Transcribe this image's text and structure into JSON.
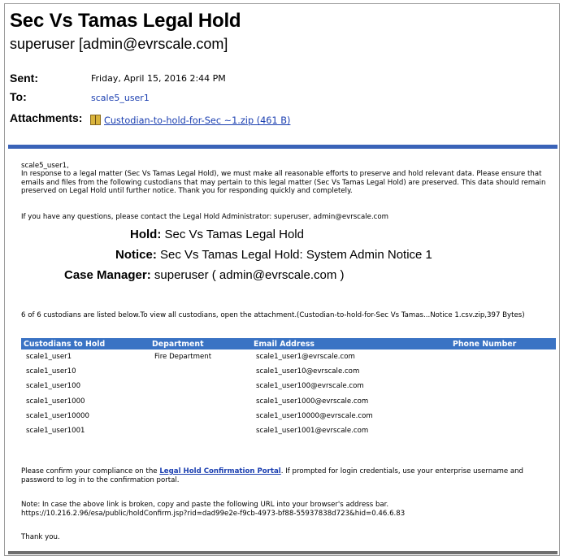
{
  "email": {
    "subject": "Sec Vs Tamas Legal Hold",
    "sender": "superuser [admin@evrscale.com]",
    "sent_label": "Sent:",
    "sent_value": "Friday, April 15, 2016 2:44 PM",
    "to_label": "To:",
    "to_value": "scale5_user1",
    "attachments_label": "Attachments:",
    "attachment_name": "Custodian-to-hold-for-Sec ~1.zip (461 B)",
    "attachment_icon": "zip-file-icon"
  },
  "body": {
    "greeting": "scale5_user1,",
    "paragraph": "In response to a legal matter (Sec Vs Tamas Legal Hold), we must make all reasonable efforts to preserve and hold relevant data. Please ensure that emails and files from the following custodians that may pertain to this legal matter (Sec Vs Tamas Legal Hold) are preserved. This data should remain preserved on Legal Hold until further notice. Thank you for responding quickly and completely.",
    "contact": "If you have any questions, please contact the Legal Hold Administrator: superuser, admin@evrscale.com",
    "hold_label": "Hold:",
    "hold_value": "Sec Vs Tamas Legal Hold",
    "notice_label": "Notice:",
    "notice_value": "Sec Vs Tamas Legal Hold: System Admin Notice 1",
    "case_manager_label": "Case Manager:",
    "case_manager_value": "superuser ( admin@evrscale.com )",
    "custodian_summary": "6 of 6 custodians are listed below.To view all custodians, open the attachment.(Custodian-to-hold-for-Sec Vs Tamas...Notice 1.csv.zip,397 Bytes)",
    "confirm_pre": "Please confirm your compliance on the ",
    "confirm_link": "Legal Hold Confirmation Portal",
    "confirm_post": ". If prompted for login credentials, use your enterprise username and password to log in to the confirmation portal.",
    "note": "Note: In case the above link is broken, copy and paste the following URL into your browser's address bar.",
    "url": "https://10.216.2.96/esa/public/holdConfirm.jsp?rid=dad99e2e-f9cb-4973-bf88-55937838d723&hid=0.46.6.83",
    "thanks": "Thank you."
  },
  "table": {
    "headers": [
      "Custodians to Hold",
      "Department",
      "Email Address",
      "Phone Number"
    ],
    "rows": [
      [
        "scale1_user1",
        "Fire Department",
        "scale1_user1@evrscale.com",
        ""
      ],
      [
        "scale1_user10",
        "",
        "scale1_user10@evrscale.com",
        ""
      ],
      [
        "scale1_user100",
        "",
        "scale1_user100@evrscale.com",
        ""
      ],
      [
        "scale1_user1000",
        "",
        "scale1_user1000@evrscale.com",
        ""
      ],
      [
        "scale1_user10000",
        "",
        "scale1_user10000@evrscale.com",
        ""
      ],
      [
        "scale1_user1001",
        "",
        "scale1_user1001@evrscale.com",
        ""
      ]
    ]
  },
  "colors": {
    "accent_bar": "#3a63b8",
    "table_header": "#3a73c4",
    "link": "#1a3eb0"
  }
}
